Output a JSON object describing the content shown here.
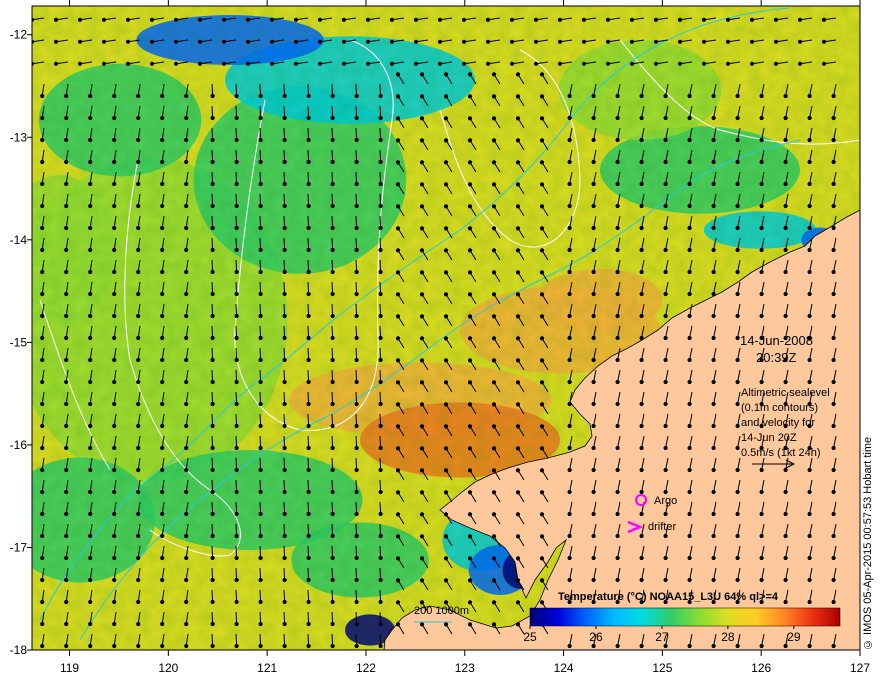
{
  "map": {
    "x_ticks": [
      "119",
      "120",
      "121",
      "122",
      "123",
      "124",
      "125",
      "126",
      "127"
    ],
    "x_values": [
      119,
      120,
      121,
      122,
      123,
      124,
      125,
      126,
      127
    ],
    "y_ticks": [
      "-12",
      "-13",
      "-14",
      "-15",
      "-16",
      "-17",
      "-18"
    ],
    "y_values": [
      -12,
      -13,
      -14,
      -15,
      -16,
      -17,
      -18
    ],
    "lon_range": [
      118.62,
      127.0
    ],
    "lat_range": [
      -18.0,
      -11.72
    ],
    "land_color": "#fcc89c",
    "sea_colors": [
      "#00007a",
      "#0066ff",
      "#00ccdd",
      "#33cc66",
      "#99dd33",
      "#dddd22",
      "#f7b33a",
      "#f07a1e"
    ],
    "date": "14-Jun-2008",
    "time": "20:39Z",
    "annotation_lines": [
      "Altimetric sealevel",
      "(0.1m contours)",
      "and velocity for",
      "14-Jun 20Z",
      "0.5m/s (1kt 24h)"
    ],
    "legend_argo": "Argo",
    "legend_drifter": "drifter",
    "argo_color": "#ff00ff",
    "drifter_color": "#ff00ff",
    "isobath_label": "200  1000m",
    "isobath_color": "#22ccdd",
    "credit": "© IMOS 05-Apr-2015 00:57:53 Hobart time"
  },
  "colorbar": {
    "title": "Temperature (°C) NOAA15_L3U 64% ql>=4",
    "tick_labels": [
      "25",
      "26",
      "27",
      "28",
      "29"
    ],
    "tick_values": [
      25,
      26,
      27,
      28,
      29
    ],
    "range": [
      25,
      29.7
    ],
    "stops": [
      "#00007a",
      "#0000dd",
      "#0066ff",
      "#00bbff",
      "#00dddd",
      "#33cc66",
      "#88dd33",
      "#dddd22",
      "#ffcc22",
      "#ff8822",
      "#ee3311",
      "#aa0000"
    ]
  }
}
